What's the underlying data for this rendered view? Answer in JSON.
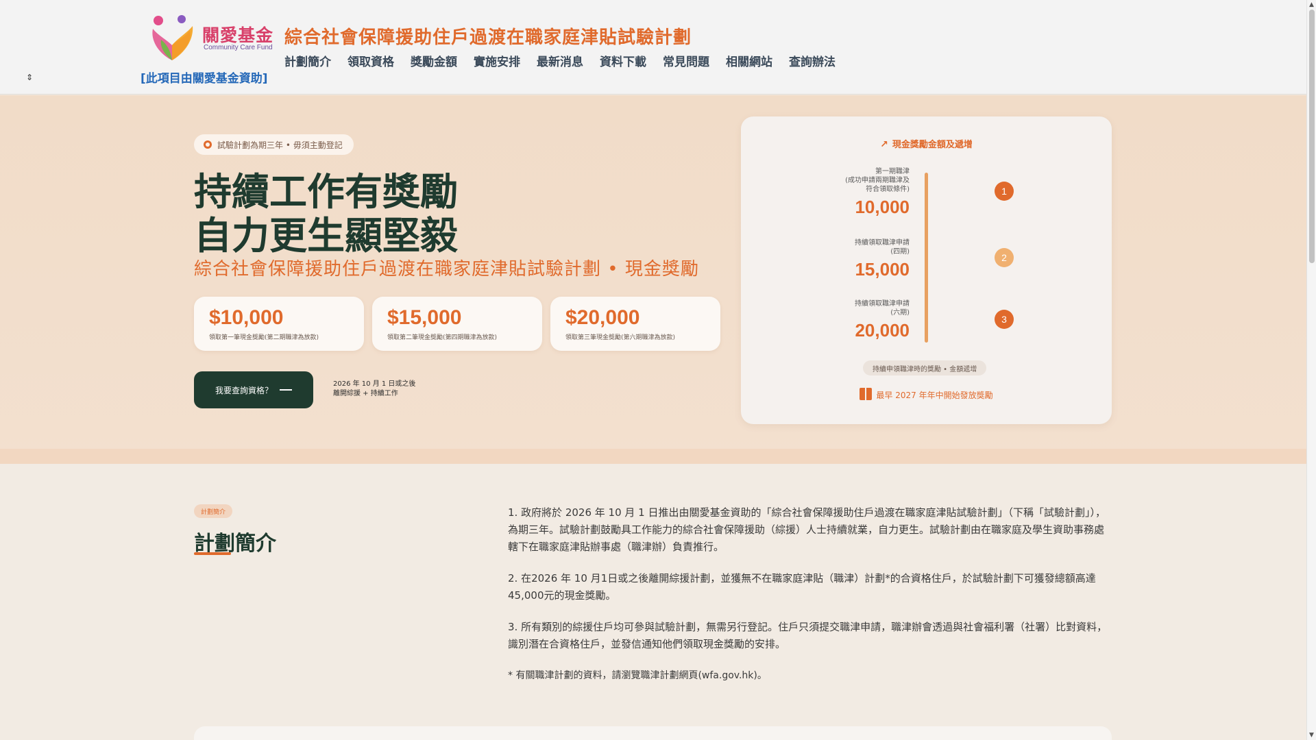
{
  "header": {
    "logo": {
      "name_zh": "關愛基金",
      "name_en": "Community Care Fund"
    },
    "funding_note": "[此項目由關愛基金資助]",
    "site_title": "綜合社會保障援助住戶過渡在職家庭津貼試驗計劃",
    "nav": [
      "計劃簡介",
      "領取資格",
      "獎勵金額",
      "實施安排",
      "最新消息",
      "資料下載",
      "常見問題",
      "相關網站",
      "查詢辦法"
    ],
    "menu_toggle_icon": "⇕"
  },
  "hero": {
    "pill": "試驗計劃為期三年 • 毋須主動登記",
    "headline_line1": "持續工作有獎勵",
    "headline_line2": "自力更生顯堅毅",
    "subtitle": "綜合社會保障援助住戶過渡在職家庭津貼試驗計劃 • 現金獎勵",
    "amounts": [
      {
        "value": "$10,000",
        "desc": "領取第一筆現金獎勵(第二期職津為放款)"
      },
      {
        "value": "$15,000",
        "desc": "領取第二筆現金獎勵(第四期職津為放款)"
      },
      {
        "value": "$20,000",
        "desc": "領取第三筆現金獎勵(第六期職津為放款)"
      }
    ],
    "cta_label": "我要查詢資格？",
    "cta_note_line1": "2026 年 10 月 1 日或之後",
    "cta_note_line2": "離開綜援 + 持續工作"
  },
  "timeline": {
    "title": "現金獎勵金額及遞增",
    "steps": [
      {
        "label_lines": [
          "第一期職津",
          "(成功申請兩期職津及",
          "符合領取條件)"
        ],
        "amount": "10,000",
        "step": "1",
        "color": "#e06a2c"
      },
      {
        "label_lines": [
          "持續領取職津申請",
          "(四期)"
        ],
        "amount": "15,000",
        "step": "2",
        "color": "#f0b070"
      },
      {
        "label_lines": [
          "持續領取職津申請",
          "(六期)"
        ],
        "amount": "20,000",
        "step": "3",
        "color": "#e06a2c"
      }
    ],
    "chip": "持續申領職津時的獎勵 • 金額遞增",
    "footer": "最早 2027 年年中開始發放獎勵"
  },
  "intro": {
    "tag": "計劃簡介",
    "title": "計劃簡介",
    "paragraphs": [
      "1. 政府將於 2026 年 10 月 1 日推出由關愛基金資助的「綜合社會保障援助住戶過渡在職家庭津貼試驗計劃」（下稱「試驗計劃」），為期三年。試驗計劃鼓勵具工作能力的綜合社會保障援助（綜援）人士持續就業，自力更生。試驗計劃由在職家庭及學生資助事務處轄下在職家庭津貼辦事處（職津辦）負責推行。",
      "2. 在2026 年 10 月1日或之後離開綜援計劃，並獲無不在職家庭津貼（職津）計劃*的合資格住戶，於試驗計劃下可獲發總額高達45,000元的現金獎勵。",
      "3. 所有類別的綜援住戶均可參與試驗計劃，無需另行登記。住戶只須提交職津申請，職津辦會透過與社會福利署（社署）比對資料，識別潛在合資格住戶，並發信通知他們領取現金獎勵的安排。"
    ],
    "footnote": "* 有關職津計劃的資料，請瀏覽職津計劃網頁(wfa.gov.hk)。"
  },
  "colors": {
    "accent": "#e06a2c",
    "dark_green": "#1f3b2f",
    "link_blue": "#2468b8"
  }
}
